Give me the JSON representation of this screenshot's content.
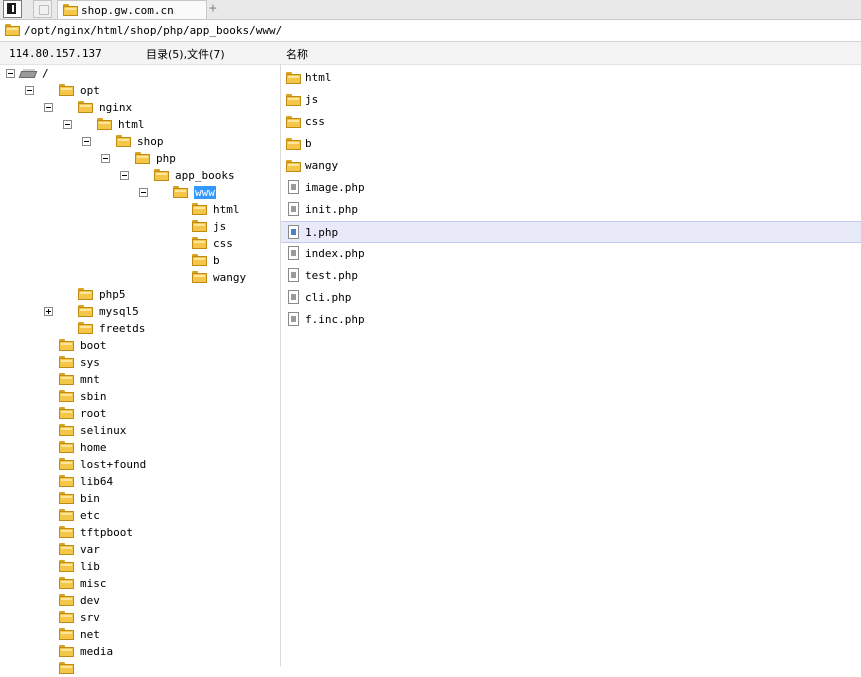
{
  "tab": {
    "title": "shop.gw.com.cn",
    "new_tab": "+"
  },
  "path": "/opt/nginx/html/shop/php/app_books/www/",
  "header": {
    "ip": "114.80.157.137",
    "summary": "目录(5),文件(7)",
    "name_col": "名称"
  },
  "tree": [
    {
      "label": "/",
      "icon": "drive-icon",
      "expand": "minus"
    },
    {
      "label": "opt",
      "icon": "folder-icon",
      "expand": "minus"
    },
    {
      "label": "nginx",
      "icon": "folder-icon",
      "expand": "minus"
    },
    {
      "label": "html",
      "icon": "folder-icon",
      "expand": "minus"
    },
    {
      "label": "shop",
      "icon": "folder-icon",
      "expand": "minus"
    },
    {
      "label": "php",
      "icon": "folder-icon",
      "expand": "minus"
    },
    {
      "label": "app_books",
      "icon": "folder-icon",
      "expand": "minus"
    },
    {
      "label": "www",
      "icon": "folder-icon",
      "expand": "minus",
      "selected": true
    },
    {
      "label": "html",
      "icon": "folder-icon"
    },
    {
      "label": "js",
      "icon": "folder-icon"
    },
    {
      "label": "css",
      "icon": "folder-icon"
    },
    {
      "label": "b",
      "icon": "folder-icon"
    },
    {
      "label": "wangy",
      "icon": "folder-icon"
    },
    {
      "label": "php5",
      "icon": "folder-icon"
    },
    {
      "label": "mysql5",
      "icon": "folder-icon",
      "expand": "plus"
    },
    {
      "label": "freetds",
      "icon": "folder-icon"
    },
    {
      "label": "boot",
      "icon": "folder-icon"
    },
    {
      "label": "sys",
      "icon": "folder-icon"
    },
    {
      "label": "mnt",
      "icon": "folder-icon"
    },
    {
      "label": "sbin",
      "icon": "folder-icon"
    },
    {
      "label": "root",
      "icon": "folder-icon"
    },
    {
      "label": "selinux",
      "icon": "folder-icon"
    },
    {
      "label": "home",
      "icon": "folder-icon"
    },
    {
      "label": "lost+found",
      "icon": "folder-icon"
    },
    {
      "label": "lib64",
      "icon": "folder-icon"
    },
    {
      "label": "bin",
      "icon": "folder-icon"
    },
    {
      "label": "etc",
      "icon": "folder-icon"
    },
    {
      "label": "tftpboot",
      "icon": "folder-icon"
    },
    {
      "label": "var",
      "icon": "folder-icon"
    },
    {
      "label": "lib",
      "icon": "folder-icon"
    },
    {
      "label": "misc",
      "icon": "folder-icon"
    },
    {
      "label": "dev",
      "icon": "folder-icon"
    },
    {
      "label": "srv",
      "icon": "folder-icon"
    },
    {
      "label": "net",
      "icon": "folder-icon"
    },
    {
      "label": "media",
      "icon": "folder-icon"
    },
    {
      "label": "",
      "icon": "folder-icon"
    }
  ],
  "files": [
    {
      "name": "html",
      "type": "folder"
    },
    {
      "name": "js",
      "type": "folder"
    },
    {
      "name": "css",
      "type": "folder"
    },
    {
      "name": "b",
      "type": "folder"
    },
    {
      "name": "wangy",
      "type": "folder"
    },
    {
      "name": "image.php",
      "type": "file"
    },
    {
      "name": "init.php",
      "type": "file"
    },
    {
      "name": "1.php",
      "type": "file",
      "selected": true
    },
    {
      "name": "index.php",
      "type": "file"
    },
    {
      "name": "test.php",
      "type": "file"
    },
    {
      "name": "cli.php",
      "type": "file"
    },
    {
      "name": "f.inc.php",
      "type": "file"
    }
  ],
  "colors": {
    "selection": "#3399ff",
    "row_highlight": "#e9eaf9",
    "folder": "#f4c64a"
  }
}
